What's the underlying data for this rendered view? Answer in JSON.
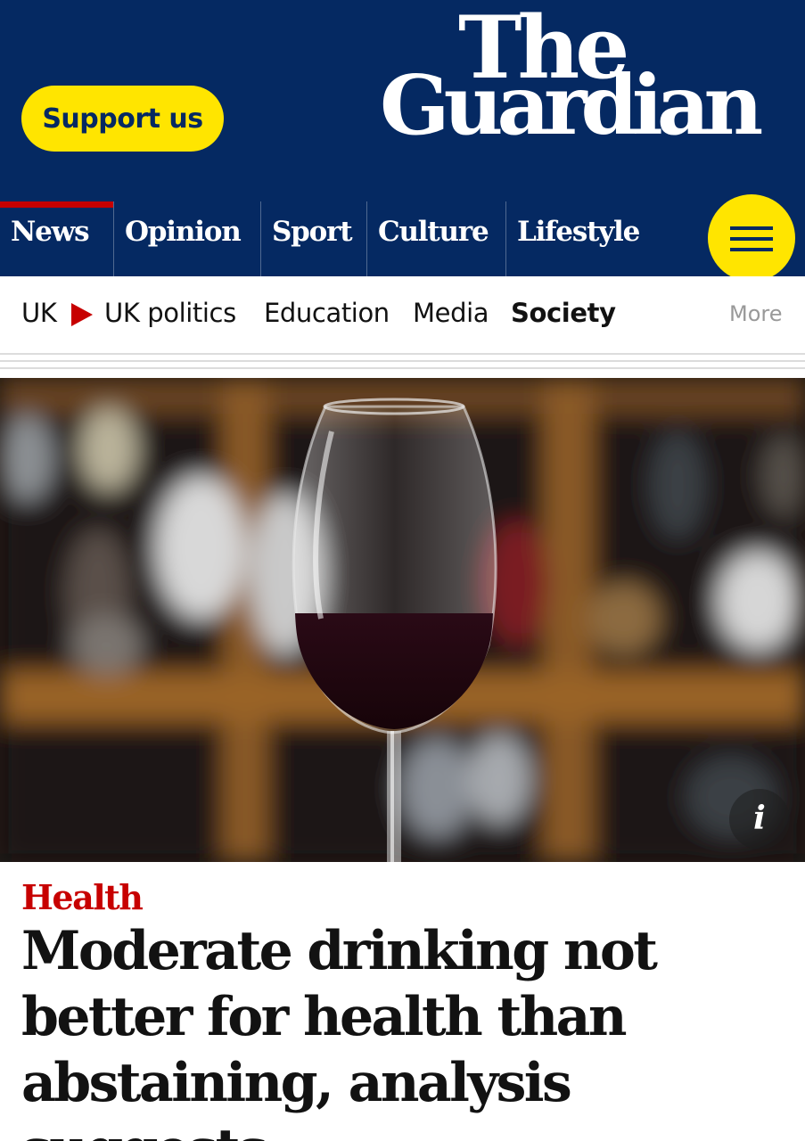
{
  "masthead": {
    "support_label": "Support us",
    "logo_line1": "The",
    "logo_line2": "Guardian"
  },
  "pillars": [
    {
      "label": "News",
      "active": true
    },
    {
      "label": "Opinion",
      "active": false
    },
    {
      "label": "Sport",
      "active": false
    },
    {
      "label": "Culture",
      "active": false
    },
    {
      "label": "Lifestyle",
      "active": false
    }
  ],
  "subnav": {
    "items": [
      "UK",
      "UK politics",
      "Education",
      "Media",
      "Society"
    ],
    "current": "Society",
    "more_label": "More"
  },
  "hero": {
    "info_label": "i"
  },
  "article": {
    "kicker": "Health",
    "headline": "Moderate drinking not better for health than abstaining, analysis suggests"
  },
  "colors": {
    "brand_blue": "#052962",
    "support_yellow": "#ffe500",
    "news_red": "#c70000"
  }
}
